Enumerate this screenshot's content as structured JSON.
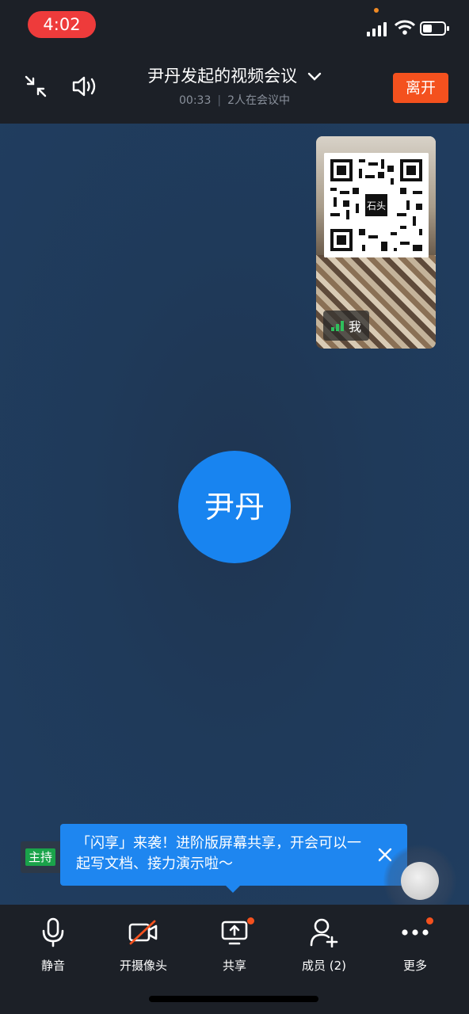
{
  "status_bar": {
    "time": "4:02"
  },
  "header": {
    "title": "尹丹发起的视频会议",
    "duration": "00:33",
    "participants_text": "2人在会议中",
    "leave_label": "离开"
  },
  "self_view": {
    "label": "我"
  },
  "remote": {
    "avatar_name": "尹丹"
  },
  "host_badge": {
    "label": "主持"
  },
  "tip": {
    "text": "「闪享」来袭！进阶版屏幕共享，开会可以一起写文档、接力演示啦～"
  },
  "toolbar": {
    "mute_label": "静音",
    "camera_label": "开摄像头",
    "share_label": "共享",
    "members_label": "成员 (2)",
    "more_label": "更多"
  },
  "colors": {
    "accent_blue": "#1e86f0",
    "leave_orange": "#f4511e",
    "host_green": "#1aa34a",
    "bar_dark": "#1c2027"
  }
}
